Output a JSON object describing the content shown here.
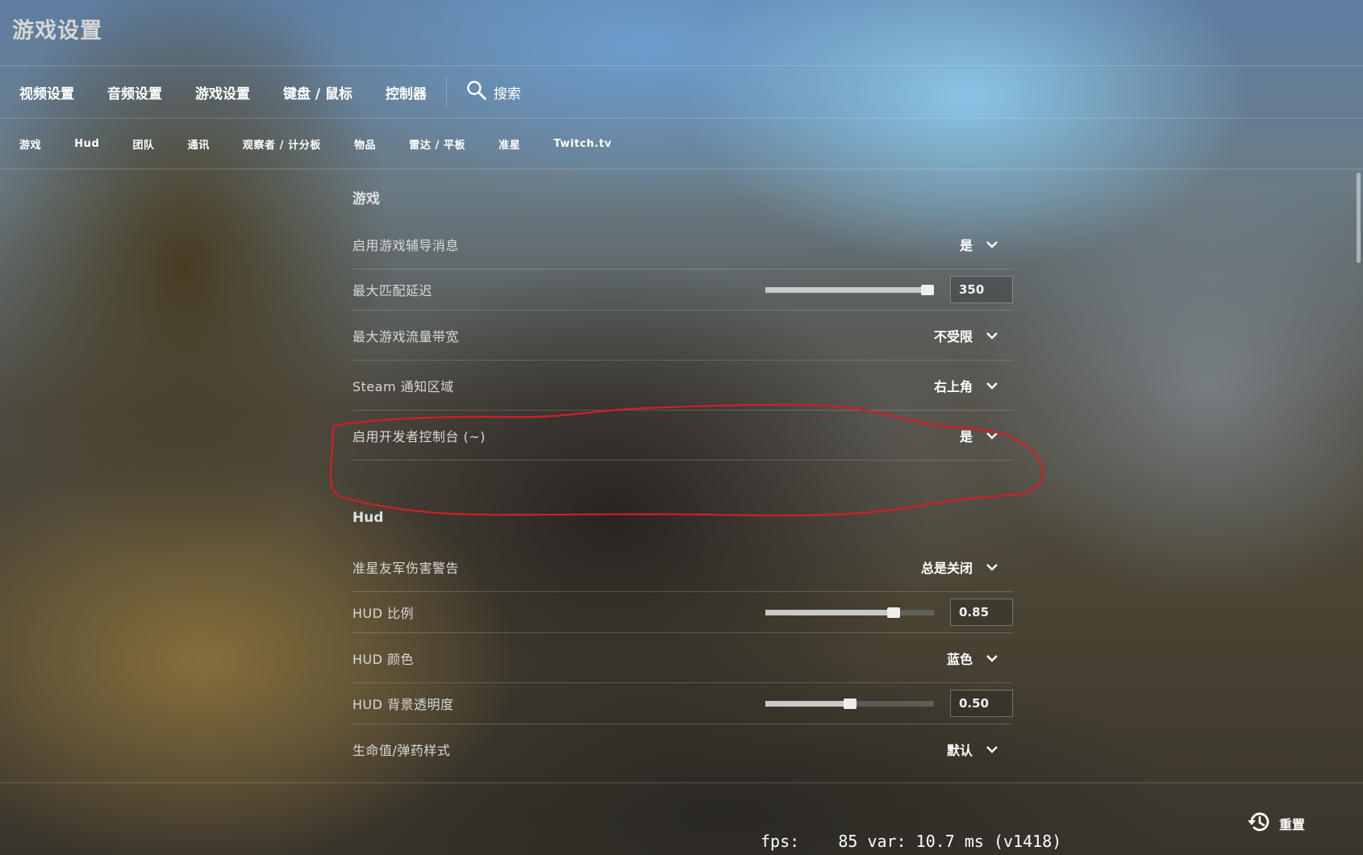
{
  "page": {
    "title": "游戏设置"
  },
  "top_nav": {
    "tabs": [
      "视频设置",
      "音频设置",
      "游戏设置",
      "键盘 / 鼠标",
      "控制器"
    ],
    "search_label": "搜索",
    "search_icon": "search-icon"
  },
  "sub_nav": {
    "tabs": [
      "游戏",
      "Hud",
      "团队",
      "通讯",
      "观察者 / 计分板",
      "物品",
      "雷达 / 平板",
      "准星",
      "Twitch.tv"
    ]
  },
  "sections": {
    "game": {
      "title": "游戏",
      "rows": {
        "tutorial": {
          "label": "启用游戏辅导消息",
          "value": "是"
        },
        "max_ping": {
          "label": "最大匹配延迟",
          "value": "350",
          "fraction": 0.96
        },
        "bandwidth": {
          "label": "最大游戏流量带宽",
          "value": "不受限"
        },
        "steam_notify": {
          "label": "Steam 通知区域",
          "value": "右上角"
        },
        "dev_console": {
          "label": "启用开发者控制台 (~)",
          "value": "是"
        }
      }
    },
    "hud": {
      "title": "Hud",
      "rows": {
        "ff_warning": {
          "label": "准星友军伤害警告",
          "value": "总是关闭"
        },
        "hud_scale": {
          "label": "HUD 比例",
          "value": "0.85",
          "fraction": 0.76
        },
        "hud_color": {
          "label": "HUD 颜色",
          "value": "蓝色"
        },
        "hud_alpha": {
          "label": "HUD 背景透明度",
          "value": "0.50",
          "fraction": 0.5
        },
        "health_style": {
          "label": "生命值/弹药样式",
          "value": "默认"
        }
      }
    }
  },
  "footer": {
    "fps_text": "fps:    85 var: 10.7 ms (v1418)",
    "reset_label": "重置",
    "reset_icon": "history-reset-icon"
  },
  "colors": {
    "annotation": "#d21f26"
  }
}
